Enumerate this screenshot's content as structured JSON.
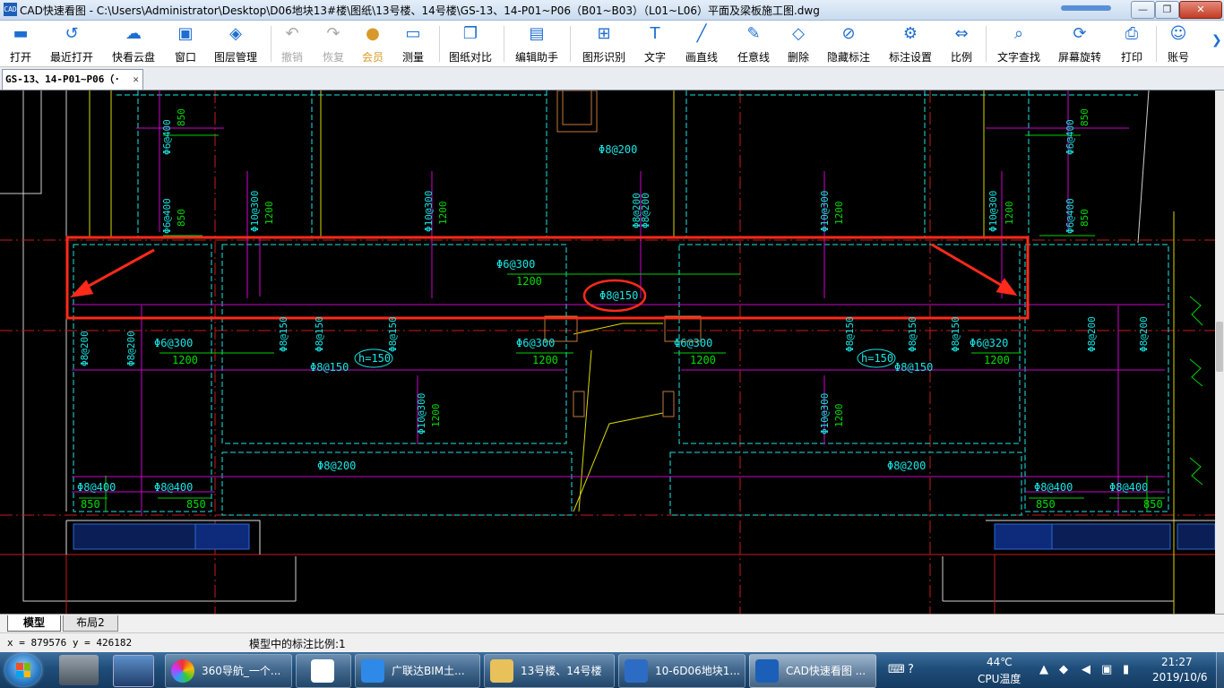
{
  "window": {
    "title": "CAD快速看图 - C:\\Users\\Administrator\\Desktop\\D06地块13#楼\\图纸\\13号楼、14号楼\\GS-13、14-P01~P06（B01~B03）（L01~L06）平面及梁板施工图.dwg",
    "app_icon": "CAD",
    "minimize": "—",
    "maximize": "❐",
    "close": "✕"
  },
  "toolbar": {
    "items": [
      {
        "label": "打开",
        "icon": "folder-open"
      },
      {
        "label": "最近打开",
        "icon": "history"
      },
      {
        "label": "快看云盘",
        "icon": "cloud"
      },
      {
        "label": "窗口",
        "icon": "window"
      },
      {
        "label": "图层管理",
        "icon": "layers"
      },
      {
        "label": "撤销",
        "icon": "undo"
      },
      {
        "label": "恢复",
        "icon": "redo"
      },
      {
        "label": "会员",
        "icon": "vip"
      },
      {
        "label": "测量",
        "icon": "ruler"
      },
      {
        "label": "图纸对比",
        "icon": "compare"
      },
      {
        "label": "编辑助手",
        "icon": "edit-assistant"
      },
      {
        "label": "图形识别",
        "icon": "shape-recognize"
      },
      {
        "label": "文字",
        "icon": "text"
      },
      {
        "label": "画直线",
        "icon": "line"
      },
      {
        "label": "任意线",
        "icon": "pen"
      },
      {
        "label": "删除",
        "icon": "eraser"
      },
      {
        "label": "隐藏标注",
        "icon": "hide"
      },
      {
        "label": "标注设置",
        "icon": "annotation-settings"
      },
      {
        "label": "比例",
        "icon": "scale"
      },
      {
        "label": "文字查找",
        "icon": "text-search"
      },
      {
        "label": "屏幕旋转",
        "icon": "rotate"
      },
      {
        "label": "打印",
        "icon": "printer"
      },
      {
        "label": "账号",
        "icon": "user"
      }
    ],
    "more": "❯"
  },
  "document_tab": {
    "label": "GS-13、14-P01~P06（·",
    "close": "✕"
  },
  "drawing": {
    "annotations": {
      "r1": "Φ8@150",
      "r2": "Φ8@200",
      "r3": "Φ8@150",
      "r4": "Φ8@200",
      "r5": "Φ8@200",
      "b1": "h=150",
      "b2": "h=150",
      "s1": "Φ8@150",
      "s2": "Φ8@150",
      "m1": "Φ8@200",
      "m2": "Φ8@200",
      "v1": "Φ8@200",
      "v2": "Φ8@200",
      "v3": "Φ8@150",
      "v4": "Φ8@150",
      "v5": "Φ8@150",
      "v6": "Φ8@150",
      "v7": "Φ8@150",
      "v8": "Φ8@150",
      "v9": "Φ8@200",
      "v10": "Φ8@200",
      "v11": "Φ8@200",
      "v12": "Φ8@200",
      "v13": "Φ8@200",
      "c1": "Φ6@400",
      "c2": "Φ6@400",
      "c3": "Φ10@300",
      "c4": "Φ10@300",
      "c5": "Φ10@300",
      "c6": "Φ10@300",
      "c7": "Φ10@300",
      "c8": "Φ10@300",
      "c9": "Φ6@400",
      "c10": "Φ6@400",
      "c11": "Φ10@300",
      "c12": "Φ10@300",
      "l1": "Φ6@300",
      "l2": "Φ6@300",
      "l3": "Φ6@300",
      "l4": "Φ6@300",
      "l5": "Φ6@320",
      "l6": "Φ8@400",
      "l7": "Φ8@400",
      "l8": "Φ8@400",
      "l9": "Φ8@400",
      "n1200": "1200",
      "n850": "850"
    }
  },
  "layout_tabs": [
    {
      "label": "模型",
      "active": true
    },
    {
      "label": "布局2",
      "active": false
    }
  ],
  "status": {
    "coords": "x = 879576  y = 426182",
    "scale_text": "模型中的标注比例:1"
  },
  "taskbar": {
    "tasks": [
      {
        "label": "360导航_一个..."
      },
      {
        "label": ""
      },
      {
        "label": "广联达BIM土..."
      },
      {
        "label": "13号楼、14号楼"
      },
      {
        "label": "10-6D06地块1..."
      },
      {
        "label": "CAD快速看图 ..."
      }
    ],
    "cpu_temp": "44℃",
    "cpu_label": "CPU温度",
    "time": "21:27",
    "date": "2019/10/6"
  },
  "colors": {
    "cad_cyan": "#00ffff",
    "cad_green": "#00ff00",
    "cad_magenta": "#ff00ff",
    "cad_yellow": "#ffff00",
    "cad_red": "#ff0000",
    "markup_red": "#ff2a1a",
    "highlight_blue": "#1d6ed1"
  }
}
